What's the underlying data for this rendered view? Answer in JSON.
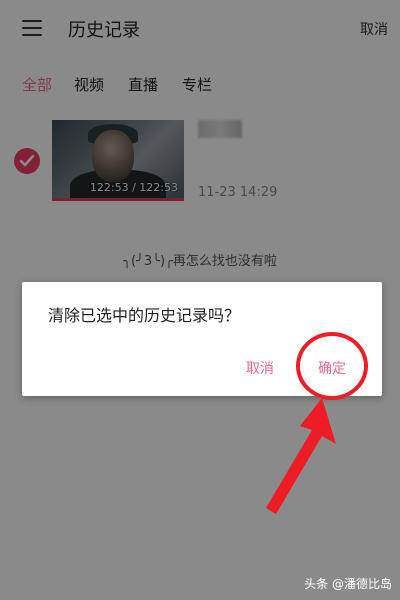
{
  "header": {
    "title": "历史记录",
    "cancel_label": "取消"
  },
  "tabs": [
    {
      "label": "全部",
      "active": true
    },
    {
      "label": "视频",
      "active": false
    },
    {
      "label": "直播",
      "active": false
    },
    {
      "label": "专栏",
      "active": false
    }
  ],
  "history": {
    "items": [
      {
        "duration": "122:53 / 122:53",
        "date": "11-23 14:29",
        "selected": true,
        "progress": 1.0
      }
    ],
    "empty_message": "╮(╯3╰)╭再怎么找也没有啦"
  },
  "dialog": {
    "message": "清除已选中的历史记录吗？",
    "cancel_label": "取消",
    "confirm_label": "确定"
  },
  "annotation": {
    "color": "#ee1c25"
  },
  "watermark": "头条 @潘德比岛",
  "colors": {
    "accent": "#f06b8a",
    "check": "#f23b66",
    "progress": "#e63a5f"
  }
}
